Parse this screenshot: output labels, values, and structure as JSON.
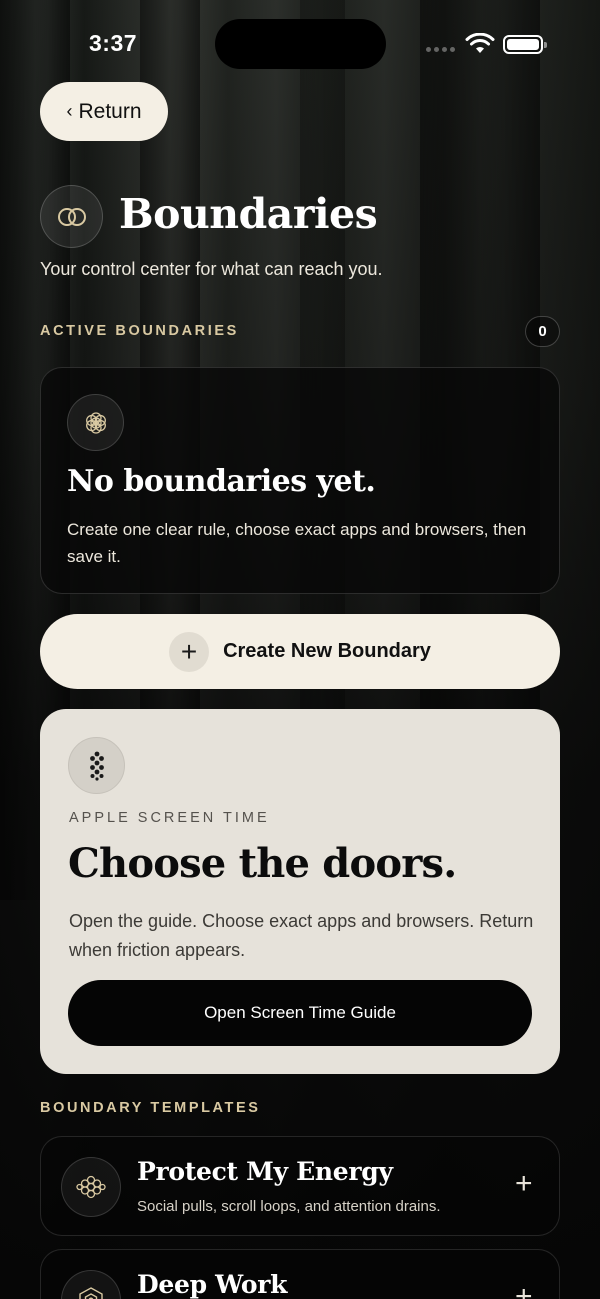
{
  "status_bar": {
    "time": "3:37"
  },
  "nav": {
    "return_label": "Return"
  },
  "header": {
    "title": "Boundaries",
    "subtitle": "Your control center for what can reach you."
  },
  "active": {
    "label": "ACTIVE BOUNDARIES",
    "count": "0",
    "empty_title": "No boundaries yet.",
    "empty_desc": "Create one clear rule, choose exact apps and browsers, then save it."
  },
  "create": {
    "label": "Create New Boundary"
  },
  "screen_time": {
    "eyebrow": "APPLE SCREEN TIME",
    "title": "Choose the doors.",
    "desc": "Open the guide. Choose exact apps and browsers. Return when friction appears.",
    "button": "Open Screen Time Guide"
  },
  "templates": {
    "label": "BOUNDARY TEMPLATES",
    "items": [
      {
        "title": "Protect My Energy",
        "desc": "Social pulls, scroll loops, and attention drains.",
        "icon": "hexagon-cluster-icon"
      },
      {
        "title": "Deep Work",
        "desc": "",
        "icon": "focus-hexagon-icon"
      }
    ]
  },
  "colors": {
    "accent": "#d9c9a2",
    "cream": "#f4efe4",
    "card_light": "#e6e2da"
  }
}
